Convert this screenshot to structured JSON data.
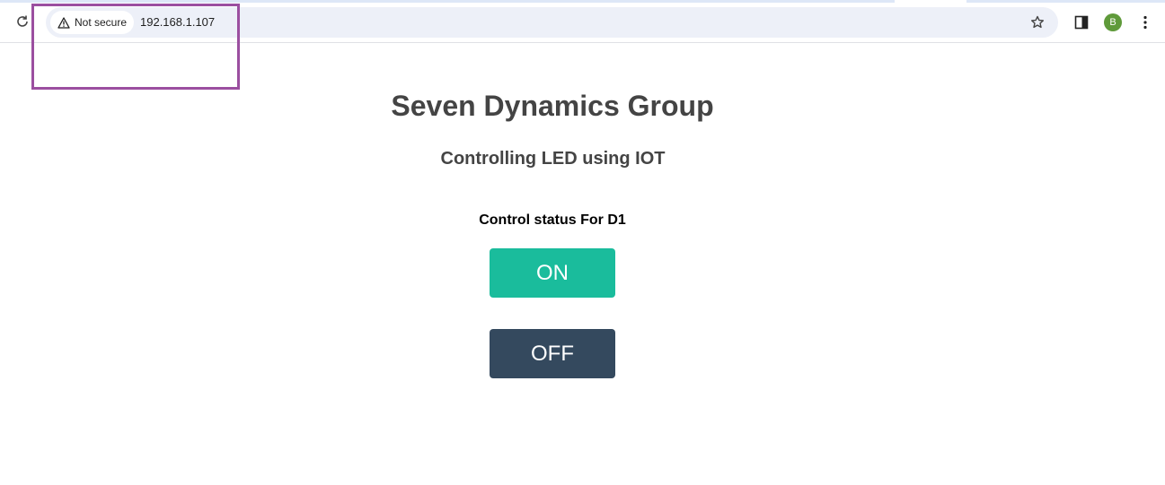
{
  "browser": {
    "security_label": "Not secure",
    "url": "192.168.1.107",
    "avatar_initial": "B",
    "icons": {
      "reload": "reload-icon",
      "warning": "warning-icon",
      "star": "star-icon",
      "side_panel": "side-panel-icon",
      "menu": "kebab-menu-icon"
    }
  },
  "page": {
    "title": "Seven Dynamics Group",
    "subtitle": "Controlling LED using IOT",
    "control_label": "Control status For D1",
    "buttons": {
      "on_label": "ON",
      "off_label": "OFF"
    }
  },
  "colors": {
    "on_button": "#1abc9c",
    "off_button": "#34495e",
    "highlight": "#9b4fa0",
    "avatar": "#5f9a3a"
  }
}
